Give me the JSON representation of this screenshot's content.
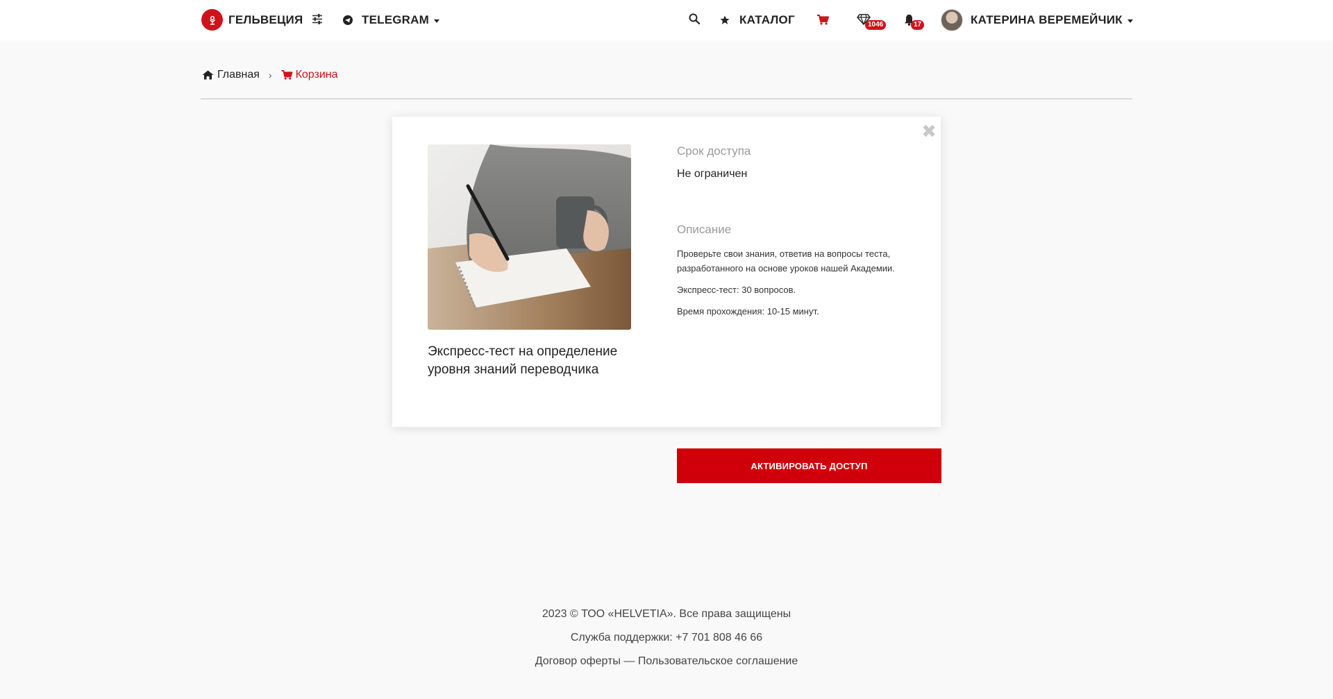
{
  "header": {
    "brand": "ГЕЛЬВЕЦИЯ",
    "telegram": "TELEGRAM",
    "catalog": "КАТАЛОГ",
    "gems_count": "1046",
    "notifications_count": "17",
    "user_name": "КАТЕРИНА ВЕРЕМЕЙЧИК",
    "icons": [
      "logo-icon",
      "filter-sliders-icon",
      "telegram-icon",
      "search-icon",
      "star-icon",
      "cart-icon",
      "diamond-icon",
      "bell-icon"
    ]
  },
  "breadcrumb": {
    "home": "Главная",
    "cart": "Корзина"
  },
  "product": {
    "title": "Экспресс-тест на определение уровня знаний переводчика",
    "access_label": "Срок доступа",
    "access_value": "Не ограничен",
    "description_label": "Описание",
    "description": [
      "Проверьте свои знания, ответив на вопросы теста, разработанного на основе уроков нашей Академии.",
      "Экспресс-тест: 30 вопросов.",
      "Время прохождения: 10-15 минут."
    ]
  },
  "actions": {
    "activate": "АКТИВИРОВАТЬ ДОСТУП"
  },
  "footer": {
    "copyright": "2023 © ТОО «HELVETIA». Все права защищены",
    "support": "Служба поддержки: +7 701 808 46 66",
    "offer": "Договор оферты",
    "dash": " — ",
    "agreement": "Пользовательское соглашение"
  },
  "colors": {
    "accent": "#d0121b",
    "background": "#f9f9f9"
  }
}
